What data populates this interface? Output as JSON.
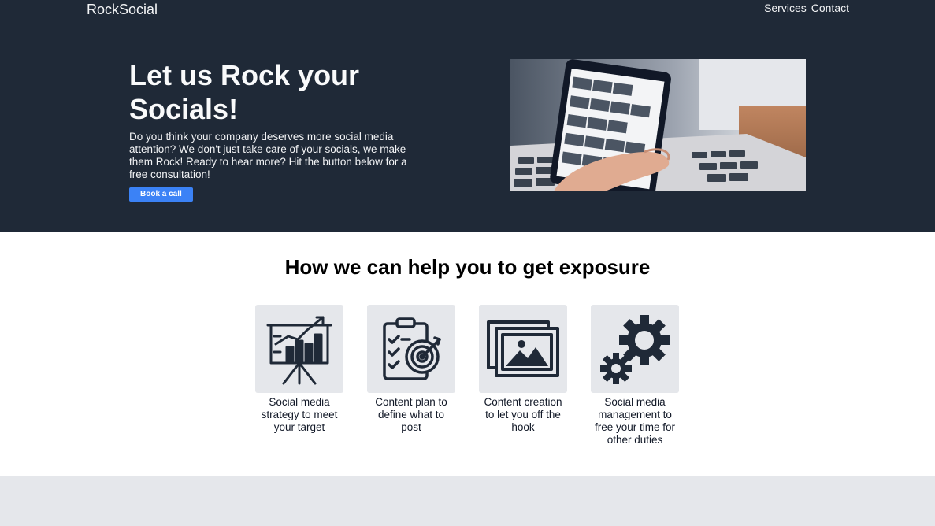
{
  "header": {
    "logo": "RockSocial",
    "nav": [
      "Services",
      "Contact"
    ]
  },
  "hero": {
    "title": "Let us Rock your Socials!",
    "text": "Do you think your company deserves more social media attention? We don't just take care of your socials, we make them Rock! Ready to hear more? Hit the button below for a free consultation!",
    "cta_label": "Book a call"
  },
  "services": {
    "title": "How we can help you to get exposure",
    "items": [
      {
        "icon": "strategy-chart-icon",
        "text": "Social media strategy to meet your target"
      },
      {
        "icon": "clipboard-target-icon",
        "text": "Content plan to define what to post"
      },
      {
        "icon": "image-gallery-icon",
        "text": "Content creation to let you off the hook"
      },
      {
        "icon": "gears-icon",
        "text": "Social media management to free your time for other duties"
      }
    ]
  },
  "colors": {
    "hero_bg": "#1f2937",
    "accent": "#3b82f6",
    "card_bg": "#e5e7eb",
    "icon": "#1f2937"
  }
}
